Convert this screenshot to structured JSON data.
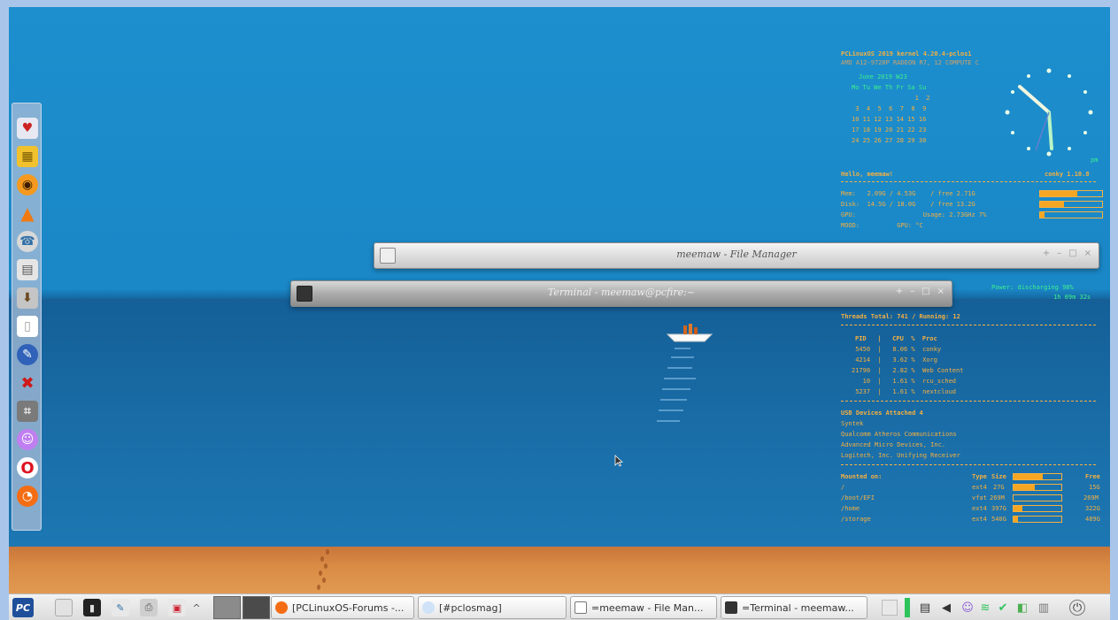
{
  "conky": {
    "header_title": "PCLinuxOS 2019 kernel 4.20.4-pclos1",
    "header_cpu": "AMD A12-9720P RADEON R7, 12 COMPUTE C",
    "calendar_month": "June 2019 W23",
    "calendar_days_header": "Mo Tu We Th Fr Sa Su",
    "calendar_rows": [
      "                 1  2",
      " 3  4  5  6  7  8  9",
      "10 11 12 13 14 15 16",
      "17 18 19 20 21 22 23",
      "24 25 26 27 28 29 30"
    ],
    "clock_ampm": "pm",
    "greeting": "Hello, meemaw!",
    "conky_version": "conky 1.10.8",
    "mem_line": "Mem:   2.09G / 4.53G    / free 2.71G",
    "disk_line": "Disk:  14.5G / 18.0G    / free 13.2G",
    "gpu_line": "GPU:                  Usage: 2.73GHz 7%",
    "mood_line": "MOOD:          GPU: °C",
    "mem_fraction": 0.6,
    "disk_fraction": 0.38,
    "gpu_fraction": 0.07,
    "power_line": "Power: discharging 98%",
    "power_time": "1h 09m 32s",
    "threads_line": "Threads Total: 741 / Running: 12",
    "proc_header": "PID   |   CPU  %  Proc",
    "processes": [
      " 5450  |   8.06 %  conky",
      " 4214  |   3.62 %  Xorg",
      "21790  |   2.82 %  Web Content",
      "   10  |   1.61 %  rcu_sched",
      " 5237  |   1.61 %  nextcloud"
    ],
    "usb_header": "USB Devices Attached 4",
    "usb_devices": [
      "Syntek",
      "Qualcomm Atheros Communications",
      "Advanced Micro Devices, Inc.",
      "Logitech, Inc. Unifying Receiver"
    ],
    "mount_header": "Mounted on:",
    "mount_cols": [
      "Type",
      "Size",
      "Free"
    ],
    "mounts": [
      {
        "path": "/",
        "type": "ext4",
        "size": "27G",
        "free": "15G",
        "fraction": 0.45
      },
      {
        "path": "/boot/EFI",
        "type": "vfat",
        "size": "269M",
        "free": "269M",
        "fraction": 0.0
      },
      {
        "path": "/home",
        "type": "ext4",
        "size": "397G",
        "free": "322G",
        "fraction": 0.19
      },
      {
        "path": "/storage",
        "type": "ext4",
        "size": "540G",
        "free": "489G",
        "fraction": 0.09
      }
    ]
  },
  "windows": {
    "file_manager_title": "meemaw - File Manager",
    "terminal_title": "Terminal - meemaw@pcfire:~"
  },
  "window_buttons": [
    "+",
    "–",
    "□",
    "×"
  ],
  "taskbar": {
    "start_label": "PC",
    "tasks": [
      {
        "label": "[PCLinuxOS-Forums -...",
        "icon": "firefox-icon"
      },
      {
        "label": "[#pclosmag]",
        "icon": "chat-icon"
      },
      {
        "label": "=meemaw - File Man...",
        "icon": "home-icon"
      },
      {
        "label": "=Terminal - meemaw...",
        "icon": "terminal-icon"
      }
    ],
    "launcher_chevron": "^"
  },
  "dock_icons": [
    "cards-icon",
    "archive-icon",
    "eye-icon",
    "vlc-cone-icon",
    "phone-icon",
    "calculator-icon",
    "install-icon",
    "document-icon",
    "blog-icon",
    "tools-icon",
    "gamepad-icon",
    "pidgin-icon",
    "opera-icon",
    "firefox-icon"
  ],
  "colors": {
    "conky_orange": "#f5b041",
    "conky_green": "#3df08d",
    "sky_blue": "#1d8fce",
    "sand": "#d98b44"
  }
}
